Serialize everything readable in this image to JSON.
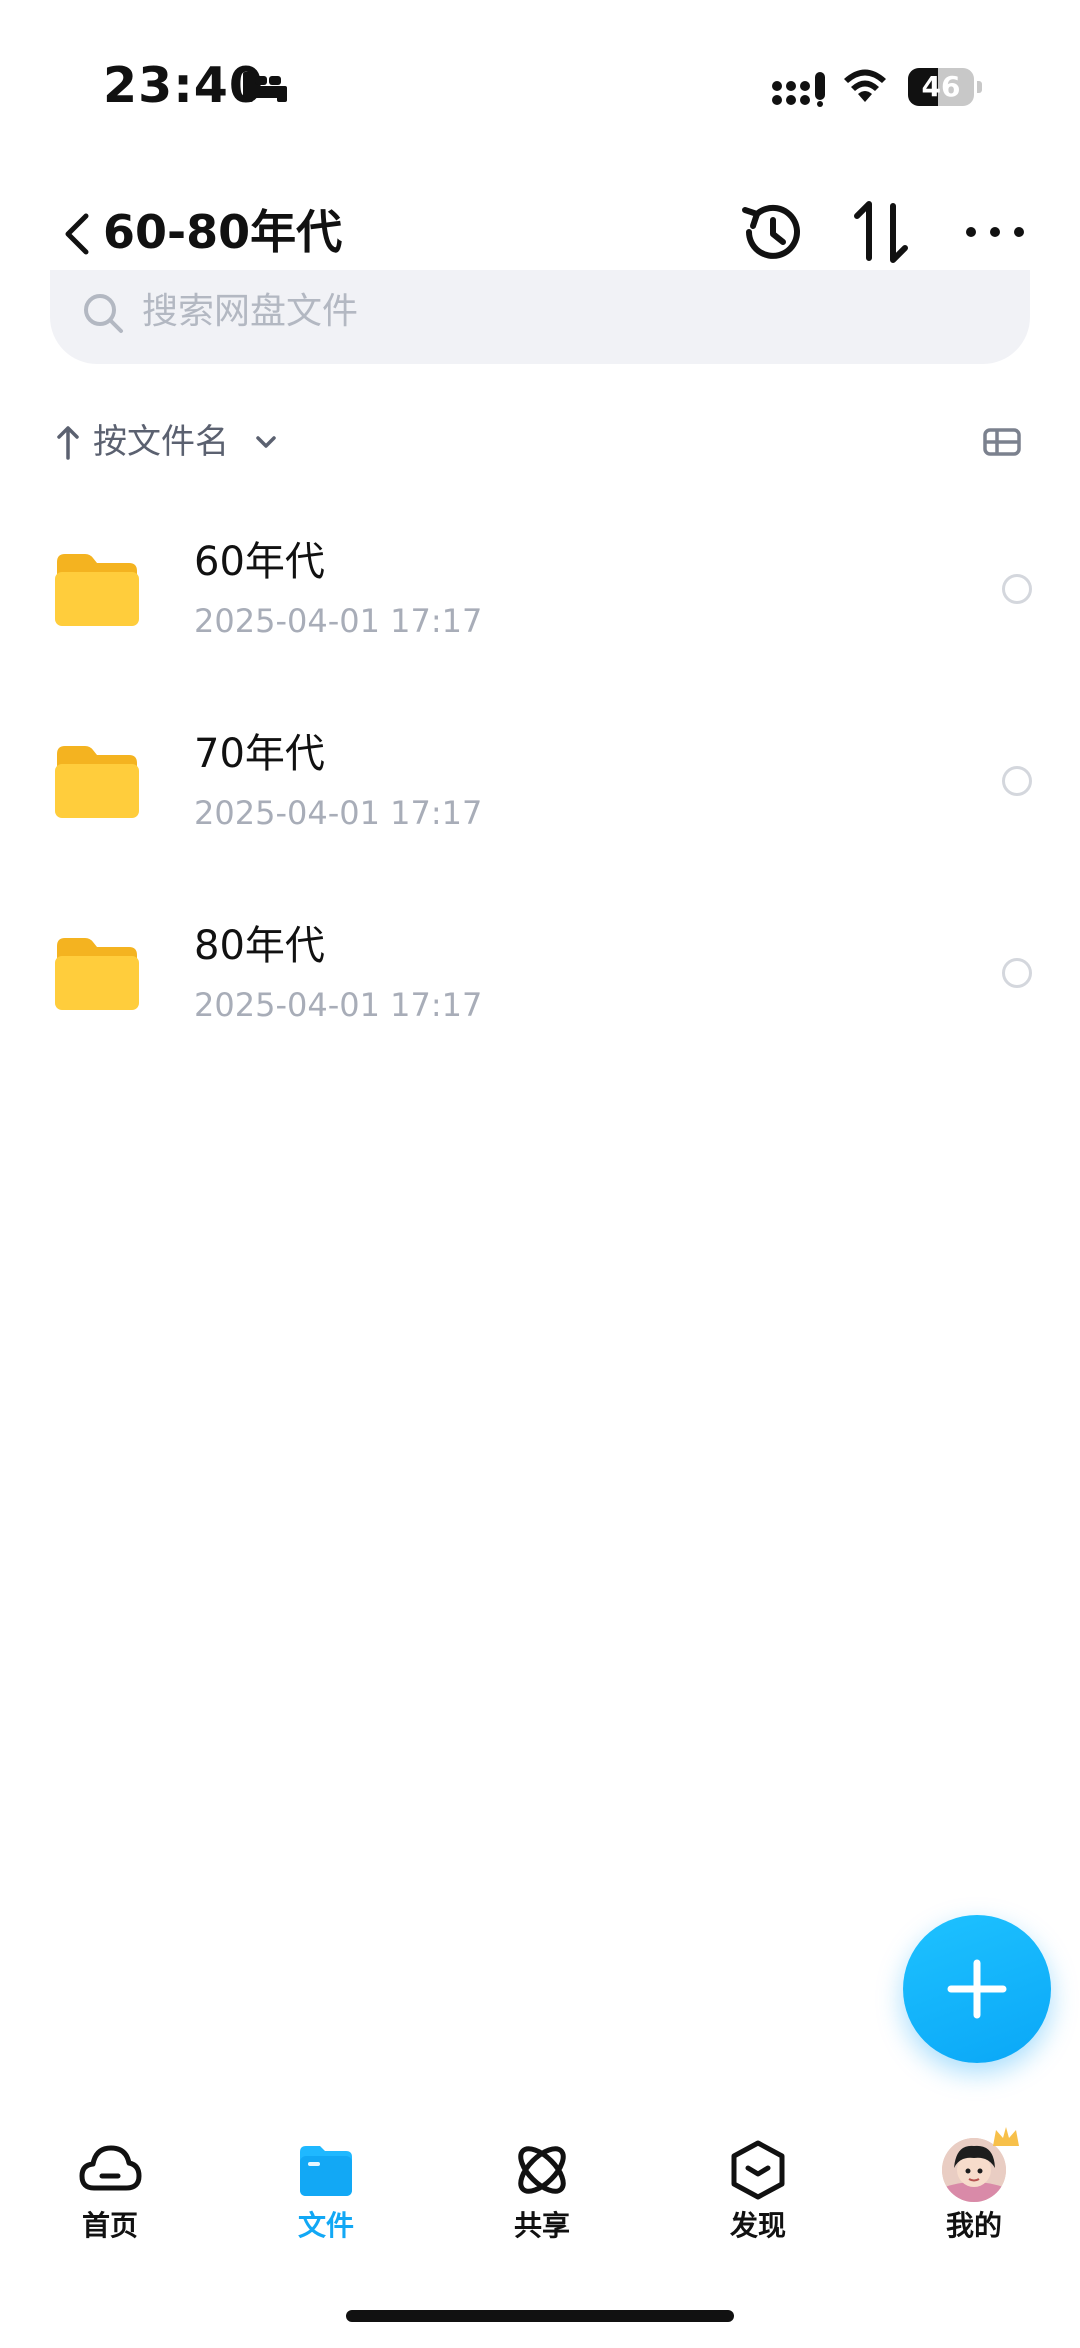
{
  "status_bar": {
    "time": "23:40",
    "battery_level": "46",
    "battery_fraction": 0.46
  },
  "nav": {
    "title": "60-80年代"
  },
  "search": {
    "placeholder": "搜索网盘文件"
  },
  "sort": {
    "label": "按文件名"
  },
  "files": [
    {
      "name": "60年代",
      "date": "2025-04-01 17:17"
    },
    {
      "name": "70年代",
      "date": "2025-04-01 17:17"
    },
    {
      "name": "80年代",
      "date": "2025-04-01 17:17"
    }
  ],
  "tabs": [
    {
      "label": "首页",
      "icon": "cloud-icon"
    },
    {
      "label": "文件",
      "icon": "folder-icon",
      "active": true
    },
    {
      "label": "共享",
      "icon": "share-orbit-icon"
    },
    {
      "label": "发现",
      "icon": "discover-box-icon"
    },
    {
      "label": "我的",
      "icon": "avatar"
    }
  ],
  "colors": {
    "accent": "#12a8f5",
    "folder": "#ffc933",
    "text_primary": "#111111",
    "text_secondary": "#a8adb8"
  }
}
